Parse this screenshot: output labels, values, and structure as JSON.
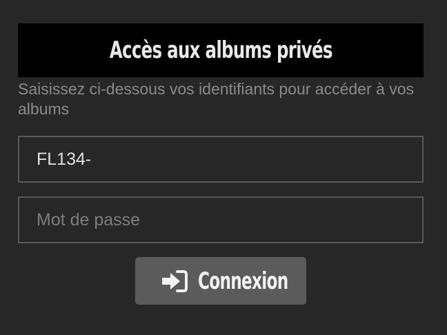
{
  "login_form": {
    "title": "Accès aux albums privés",
    "subtitle": "Saisissez ci-dessous vos identifiants pour accéder à vos albums",
    "login_value": "FL134-",
    "password_placeholder": "Mot de passe",
    "submit_label": "Connexion",
    "submit_icon": "sign-in-icon"
  },
  "colors": {
    "background": "#272727",
    "title_bar": "#000000",
    "button": "#5b5b5b",
    "field_border": "#5a5a5a"
  }
}
